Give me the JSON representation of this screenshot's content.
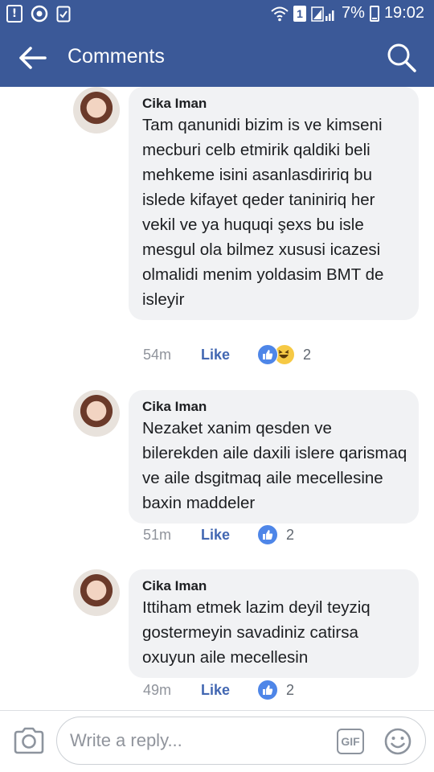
{
  "status_bar": {
    "left_icons": [
      "alert-icon",
      "sync-icon",
      "clipboard-check-icon"
    ],
    "sim": "1",
    "battery": "7%",
    "time": "19:02"
  },
  "header": {
    "title": "Comments",
    "back_icon": "arrow-left-icon",
    "search_icon": "search-icon"
  },
  "comments": [
    {
      "author": "Cika Iman",
      "text": "Tam qanunidi bizim is ve kimseni mecburi celb etmirik qaldiki beli mehkeme isini asanlasdiririq bu islede kifayet qeder taniniriq her vekil ve ya huquqi şexs bu isle mesgul ola bilmez xususi icazesi olmalidi menim yoldasim BMT de isleyir",
      "time": "54m",
      "like_label": "Like",
      "reactions": [
        "like",
        "haha"
      ],
      "reaction_count": "2"
    },
    {
      "author": "Cika Iman",
      "text": "Nezaket xanim qesden ve bilerekden aile daxili islere qarismaq ve aile dsgitmaq aile mecellesine baxin maddeler",
      "time": "51m",
      "like_label": "Like",
      "reactions": [
        "like"
      ],
      "reaction_count": "2"
    },
    {
      "author": "Cika Iman",
      "text": "Ittiham etmek lazim deyil teyziq gostermeyin savadiniz catirsa oxuyun aile mecellesin",
      "time": "49m",
      "like_label": "Like",
      "reactions": [
        "like"
      ],
      "reaction_count": "2"
    }
  ],
  "reply_bar": {
    "placeholder": "Write a reply...",
    "gif_label": "GIF",
    "camera_icon": "camera-icon",
    "emoji_icon": "smiley-icon"
  },
  "colors": {
    "brand": "#3b5998",
    "link": "#4267b2",
    "bubble": "#f1f2f4",
    "muted": "#90949c"
  }
}
